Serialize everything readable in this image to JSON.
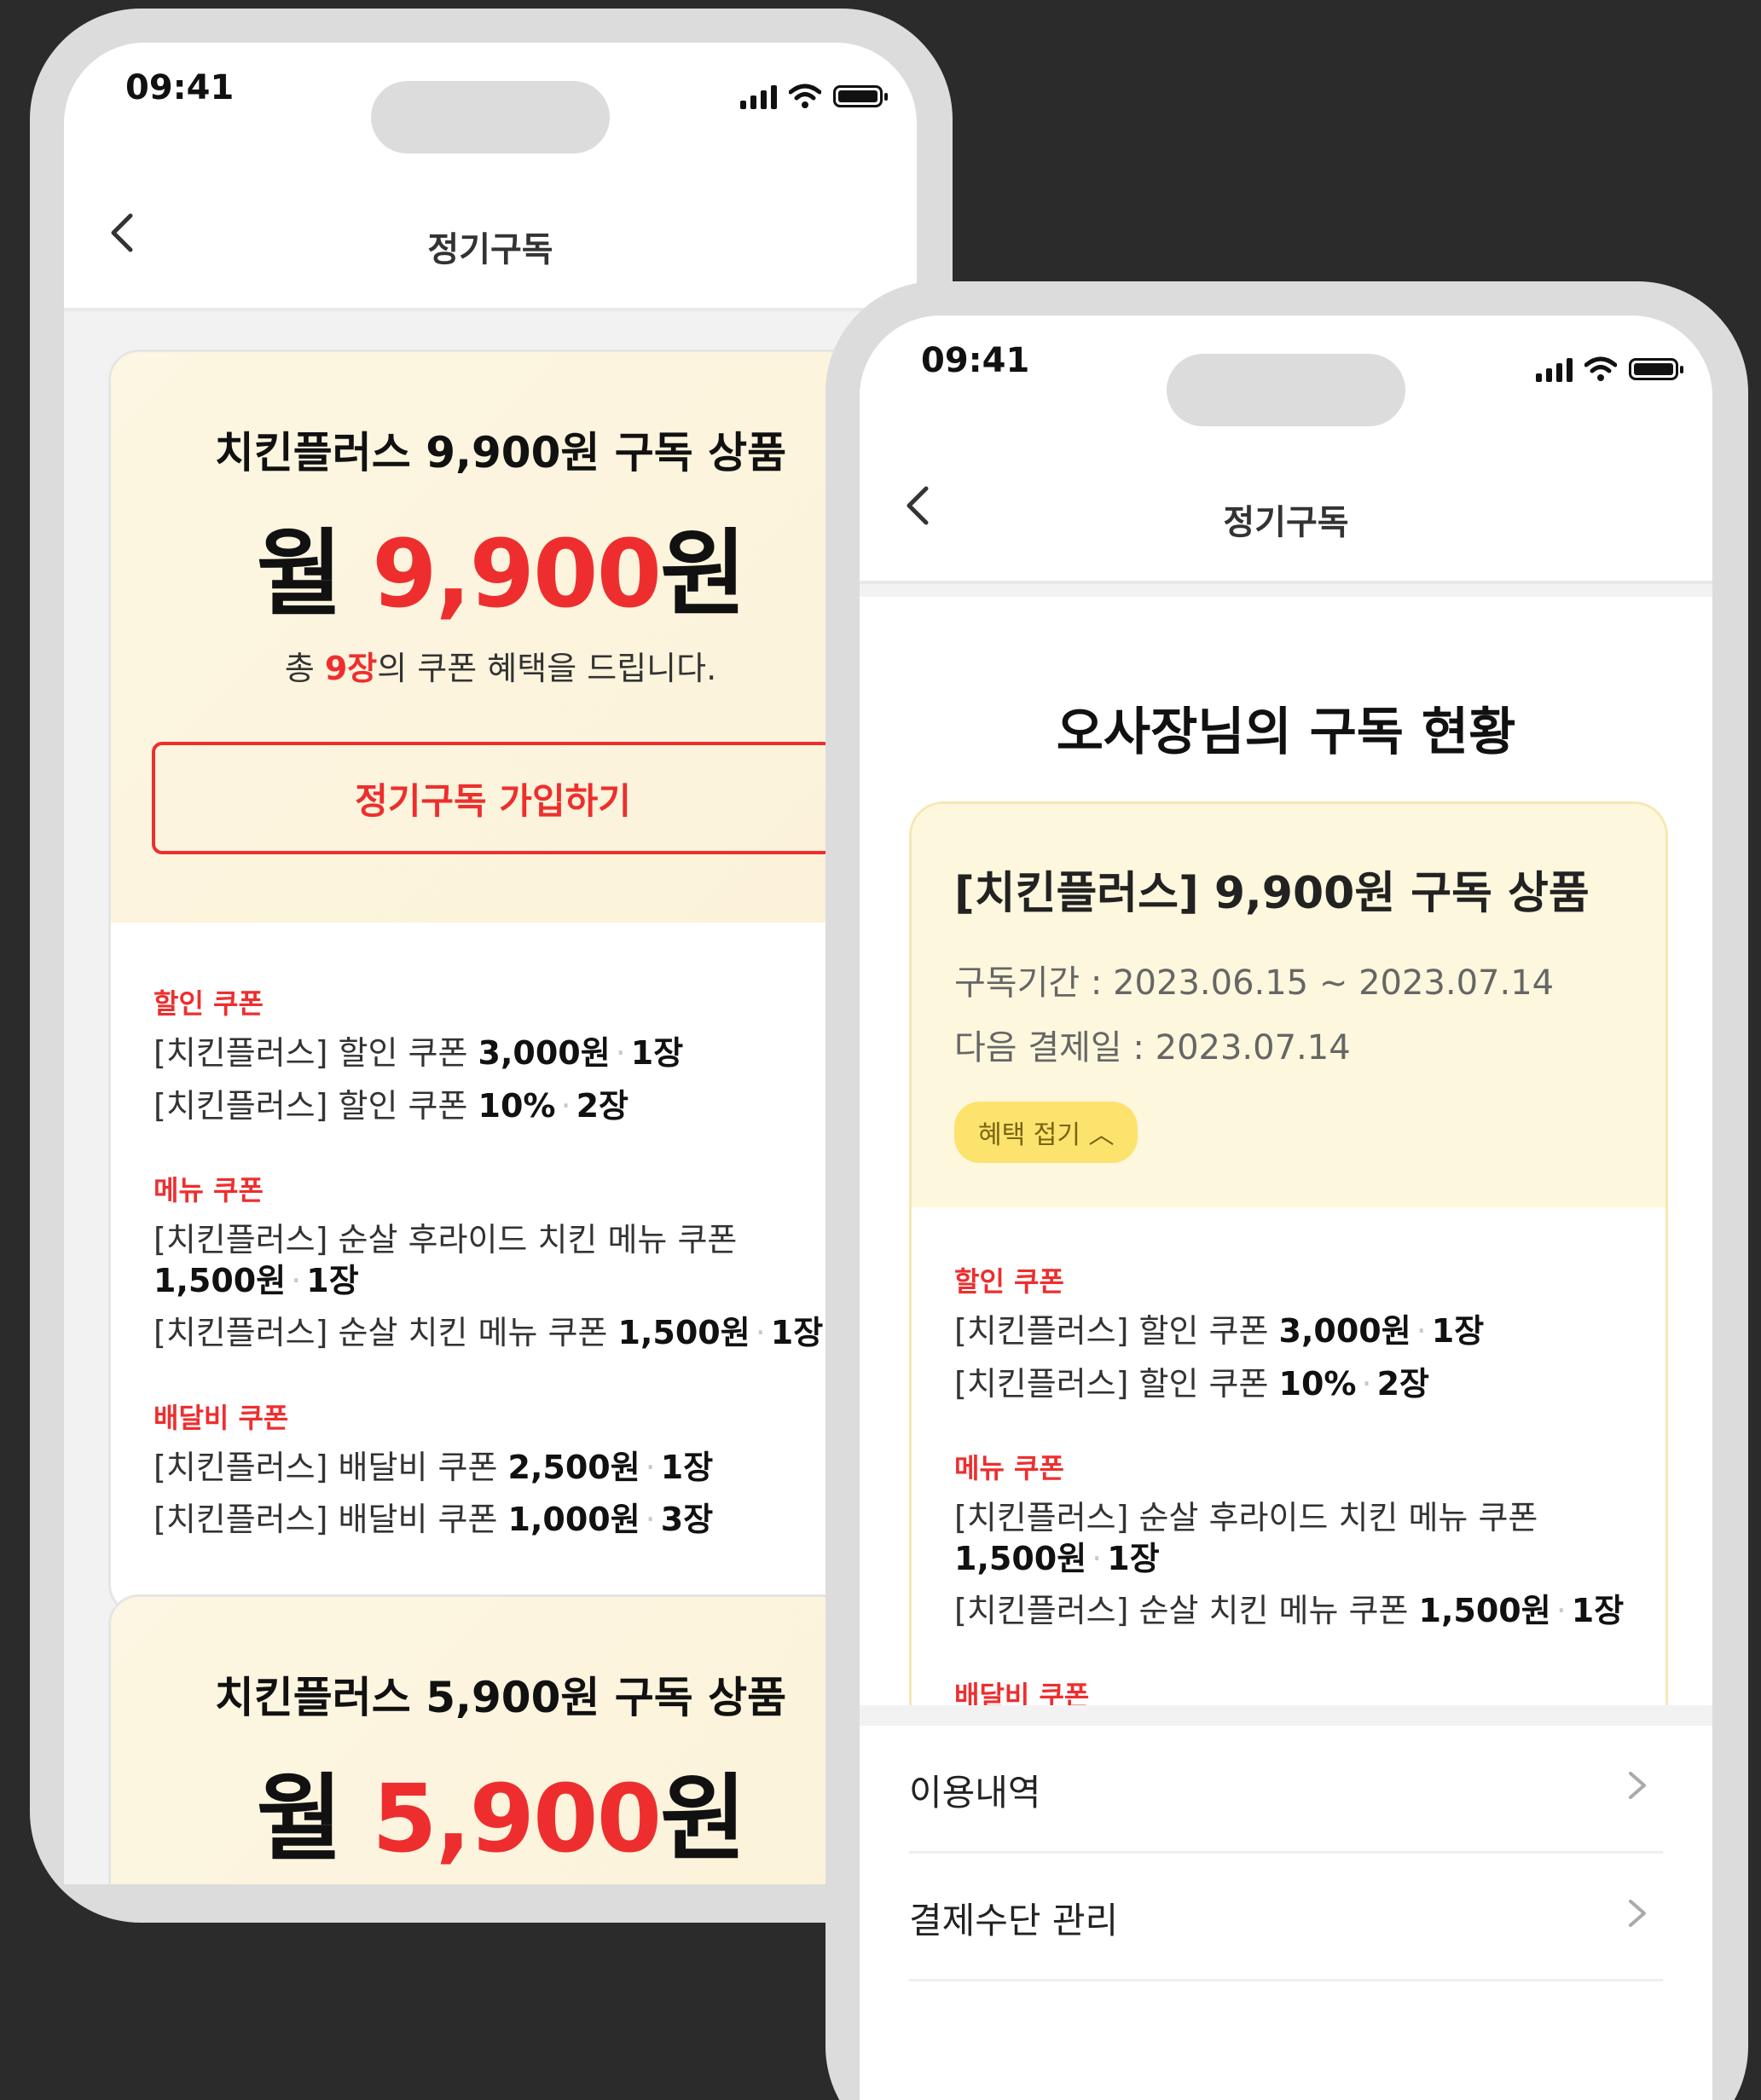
{
  "status_bar": {
    "time": "09:41"
  },
  "nav": {
    "title": "정기구독"
  },
  "product_card_1": {
    "title": "치킨플러스 9,900원 구독 상품",
    "price_prefix": "월 ",
    "price_number": "9,900",
    "price_suffix": "원",
    "total_prefix": "총 ",
    "total_count": "9장",
    "total_suffix": "의 쿠폰 혜택을 드립니다.",
    "join_button": "정기구독 가입하기"
  },
  "product_card_2": {
    "title": "치킨플러스 5,900원 구독 상품",
    "price_prefix": "월 ",
    "price_number": "5,900",
    "price_suffix": "원"
  },
  "benefits": {
    "discount_label": "할인 쿠폰",
    "discount_1_text": "[치킨플러스] 할인 쿠폰 ",
    "discount_1_amount": "3,000원",
    "discount_1_count": "1장",
    "discount_2_text": "[치킨플러스] 할인 쿠폰 ",
    "discount_2_amount": "10%",
    "discount_2_count": "2장",
    "menu_label": "메뉴 쿠폰",
    "menu_1_text": "[치킨플러스] 순살 후라이드 치킨 메뉴 쿠폰",
    "menu_1_amount": "1,500원",
    "menu_1_count": "1장",
    "menu_2_text": "[치킨플러스] 순살 치킨 메뉴 쿠폰 ",
    "menu_2_amount": "1,500원",
    "menu_2_count": "1장",
    "delivery_label": "배달비 쿠폰",
    "delivery_1_text": "[치킨플러스] 배달비 쿠폰 ",
    "delivery_1_amount": "2,500원",
    "delivery_1_count": "1장",
    "delivery_2_text": "[치킨플러스] 배달비 쿠폰 ",
    "delivery_2_amount": "1,000원",
    "delivery_2_count": "3장",
    "separator": "·"
  },
  "subscription_status": {
    "heading": "오사장님의 구독 현황",
    "product_title": "[치킨플러스] 9,900원 구독 상품",
    "period": "구독기간 : 2023.06.15 ~ 2023.07.14",
    "next_payment": "다음 결제일 : 2023.07.14",
    "toggle_label": "혜택 접기 ︿"
  },
  "menu": {
    "items": [
      "이용내역",
      "결제수단 관리"
    ]
  },
  "colors": {
    "accent_red": "#ee2e2e",
    "card_bg": "#fcf6e2",
    "pill_yellow": "#fbe36d",
    "background": "#2b2b2b"
  },
  "icons": [
    "back-chevron-icon",
    "signal-icon",
    "wifi-icon",
    "battery-icon",
    "chevron-right-icon"
  ]
}
